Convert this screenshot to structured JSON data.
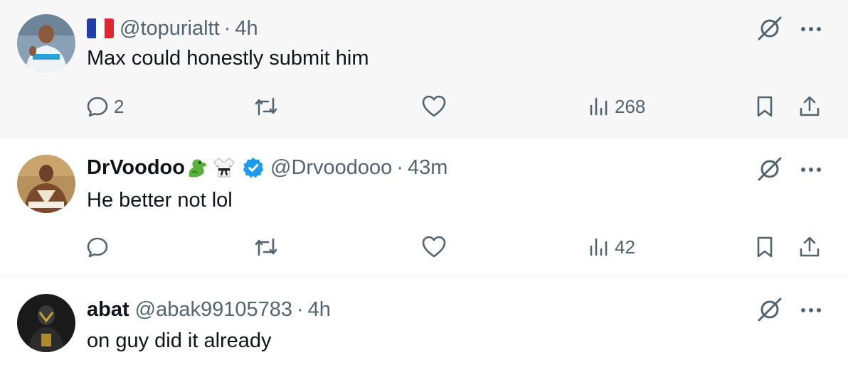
{
  "posts": [
    {
      "display_name": "",
      "handle": "@topurialtt",
      "separator": "·",
      "time": "4h",
      "text": "Max could honestly submit him",
      "reply_count": "2",
      "retweet_count": "",
      "like_count": "",
      "view_count": "268"
    },
    {
      "display_name": "DrVoodoo",
      "handle": "@Drvoodooo",
      "separator": "·",
      "time": "43m",
      "text": "He better not lol",
      "reply_count": "",
      "retweet_count": "",
      "like_count": "",
      "view_count": "42"
    },
    {
      "display_name": "abat",
      "handle": "@abak99105783",
      "separator": "·",
      "time": "4h",
      "text": "on guy did it already"
    }
  ],
  "colors": {
    "muted": "#536471",
    "verified": "#1d9bf0",
    "highlight_bg": "#f7f7f7"
  },
  "icons": [
    "reply-icon",
    "retweet-icon",
    "like-icon",
    "views-icon",
    "bookmark-icon",
    "share-icon",
    "grok-icon",
    "more-icon",
    "flag-france-icon",
    "dragon-emoji-icon",
    "martial-arts-uniform-emoji-icon",
    "verified-badge-icon"
  ]
}
